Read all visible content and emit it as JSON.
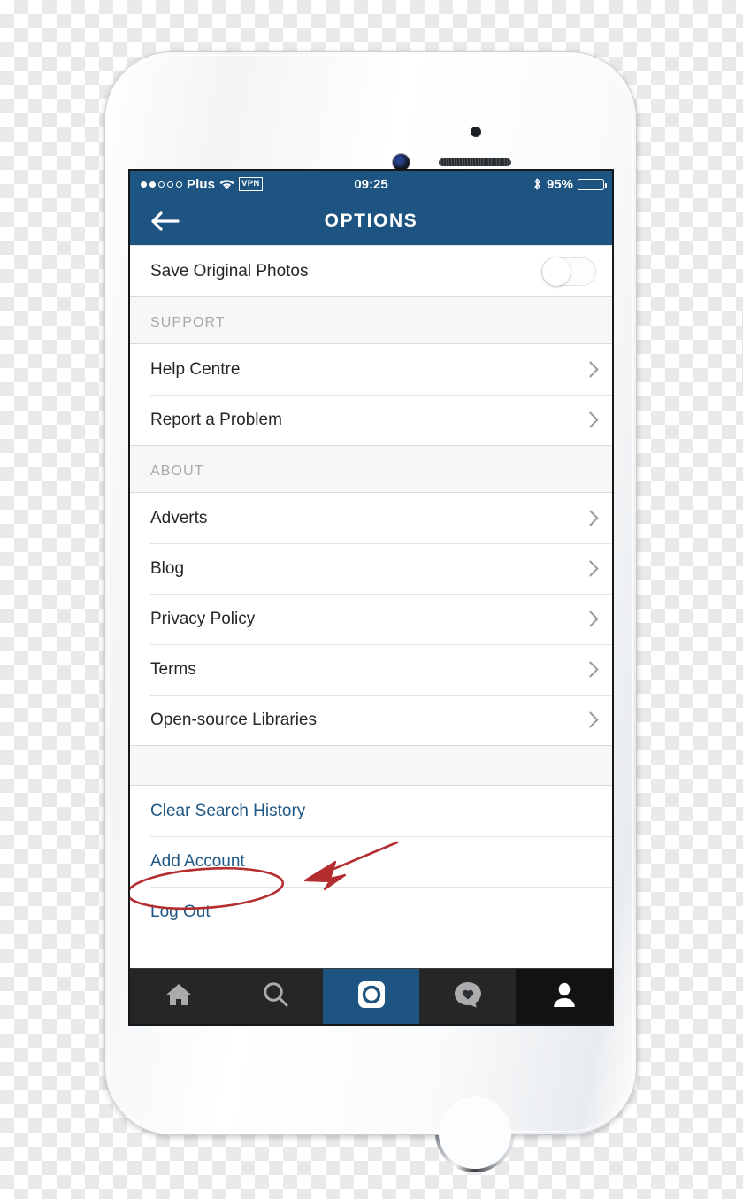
{
  "status_bar": {
    "signal_dots_total": 5,
    "signal_dots_filled": 2,
    "carrier": "Plus",
    "wifi_icon": "wifi-icon",
    "vpn_badge": "VPN",
    "time": "09:25",
    "bluetooth_icon": "bluetooth-icon",
    "battery_percent": "95%",
    "battery_level": 95
  },
  "nav_bar": {
    "back_icon": "back-arrow-icon",
    "title": "OPTIONS",
    "background_color": "#1d5481"
  },
  "list": [
    {
      "type": "row",
      "label": "Save Original Photos",
      "control": "toggle",
      "toggle_on": false
    },
    {
      "type": "section_header",
      "label": "SUPPORT"
    },
    {
      "type": "row",
      "label": "Help Centre",
      "control": "chevron"
    },
    {
      "type": "row",
      "label": "Report a Problem",
      "control": "chevron"
    },
    {
      "type": "section_header",
      "label": "ABOUT"
    },
    {
      "type": "row",
      "label": "Adverts",
      "control": "chevron"
    },
    {
      "type": "row",
      "label": "Blog",
      "control": "chevron"
    },
    {
      "type": "row",
      "label": "Privacy Policy",
      "control": "chevron"
    },
    {
      "type": "row",
      "label": "Terms",
      "control": "chevron"
    },
    {
      "type": "row",
      "label": "Open-source Libraries",
      "control": "chevron"
    },
    {
      "type": "gap"
    },
    {
      "type": "row",
      "label": "Clear Search History",
      "style": "link"
    },
    {
      "type": "row",
      "label": "Add Account",
      "style": "link",
      "annotated": true
    },
    {
      "type": "row",
      "label": "Log Out",
      "style": "link"
    }
  ],
  "tab_bar": {
    "background_color": "#262626",
    "tabs": [
      {
        "icon": "home-icon",
        "label": "Home",
        "active": false
      },
      {
        "icon": "search-icon",
        "label": "Search",
        "active": false
      },
      {
        "icon": "camera-icon",
        "label": "Camera",
        "active": true,
        "highlight_color": "#1d5481"
      },
      {
        "icon": "activity-heart-icon",
        "label": "Activity",
        "active": false
      },
      {
        "icon": "profile-icon",
        "label": "Profile",
        "active": true
      }
    ]
  },
  "annotation": {
    "color": "#b42d2f",
    "ellipse_target": "Add Account",
    "arrow_points_to": "Add Account"
  },
  "device": {
    "type": "white-smartphone",
    "earpiece_icon": "earpiece-speaker",
    "front_camera_icon": "front-camera",
    "home_button_icon": "home-button"
  }
}
